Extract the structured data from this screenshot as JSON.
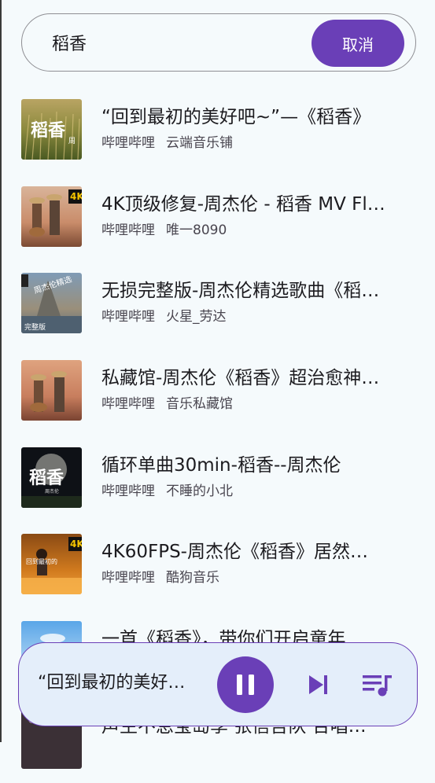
{
  "colors": {
    "accent": "#6a3fb7",
    "background": "#f5fafc",
    "player_background": "#e4eefa",
    "secondary_text": "#49454f"
  },
  "search": {
    "value": "稻香",
    "cancel_label": "取消"
  },
  "results": [
    {
      "title": "“回到最初的美好吧~”—《稻香》",
      "source": "哔哩哔哩",
      "uploader": "云端音乐铺",
      "thumb": "rice-field-calligraphy"
    },
    {
      "title": "4K顶级修复-周杰伦 - 稻香 MV Fl…",
      "source": "哔哩哔哩",
      "uploader": "唯一8090",
      "thumb": "guitar-duo-4k"
    },
    {
      "title": "无损完整版-周杰伦精选歌曲《稻…",
      "source": "哔哩哔哩",
      "uploader": "火星_劳达",
      "thumb": "castle-collection"
    },
    {
      "title": "私藏馆-周杰伦《稻香》超治愈神…",
      "source": "哔哩哔哩",
      "uploader": "音乐私藏馆",
      "thumb": "guitar-duo"
    },
    {
      "title": "循环单曲30min-稻香--周杰伦",
      "source": "哔哩哔哩",
      "uploader": "不睡的小北",
      "thumb": "moon-calligraphy"
    },
    {
      "title": "4K60FPS-周杰伦《稻香》居然…",
      "source": "哔哩哔哩",
      "uploader": "酷狗音乐",
      "thumb": "concert-4k"
    },
    {
      "title": "一首《稻香》，带你们开启童年…",
      "source": "",
      "uploader": "",
      "thumb": "sky-blue"
    },
    {
      "title": "声生不息宝岛季 张信哲队 合唱…",
      "source": "",
      "uploader": "",
      "thumb": "group-stage"
    }
  ],
  "player": {
    "title": "“回到最初的美好…",
    "icons": {
      "play_pause": "pause-icon",
      "next": "skip-next-icon",
      "queue": "queue-music-icon"
    }
  }
}
